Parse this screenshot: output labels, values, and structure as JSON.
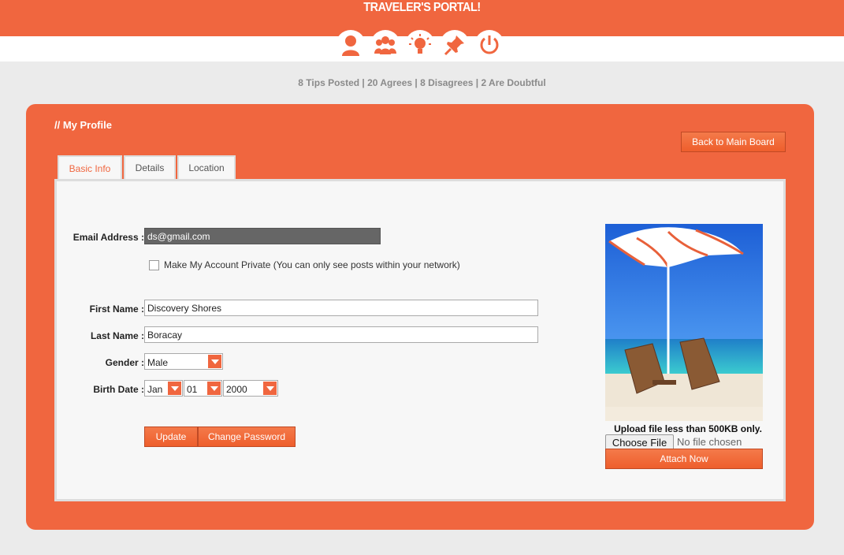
{
  "header": {
    "title": "TRAVELER'S PORTAL!",
    "nav": [
      "profile-icon",
      "group-icon",
      "lightbulb-icon",
      "pin-icon",
      "power-icon"
    ]
  },
  "stats": "8 Tips Posted | 20 Agrees | 8 Disagrees | 2 Are Doubtful",
  "profile": {
    "title": "// My Profile",
    "back_label": "Back to Main Board",
    "tabs": [
      "Basic Info",
      "Details",
      "Location"
    ],
    "active_tab": "Basic Info",
    "email_label": "Email Address :",
    "email_value": "ds@gmail.com",
    "private_label": "Make My Account Private (You can only see posts within your network)",
    "private_checked": false,
    "first_name_label": "First Name :",
    "first_name_value": "Discovery Shores",
    "last_name_label": "Last Name :",
    "last_name_value": "Boracay",
    "gender_label": "Gender :",
    "gender_value": "Male",
    "birth_label": "Birth Date :",
    "birth_month": "Jan",
    "birth_day": "01",
    "birth_year": "2000",
    "update_label": "Update",
    "change_password_label": "Change Password"
  },
  "upload": {
    "note": "Upload file less than 500KB only.",
    "choose_label": "Choose File",
    "status": "No file chosen",
    "attach_label": "Attach Now"
  },
  "colors": {
    "brand": "#f0663f",
    "panel_bg": "#f7f7f7",
    "page_bg": "#ebebeb"
  }
}
